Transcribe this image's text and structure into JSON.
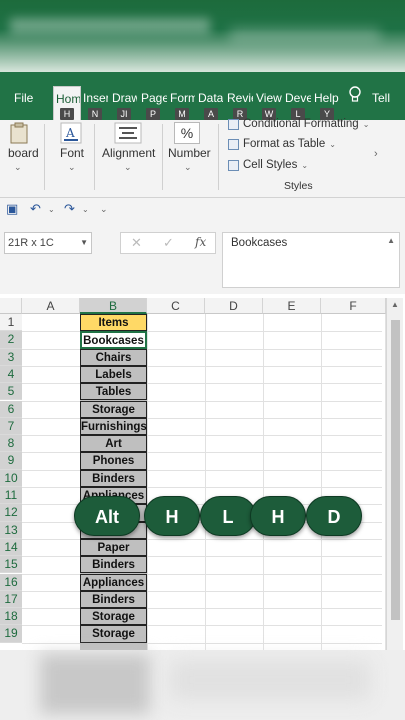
{
  "window": {
    "title_blurred": "Duplicate Highlight"
  },
  "ribbon": {
    "tabs": [
      {
        "label": "File",
        "keytip": ""
      },
      {
        "label": "Hom",
        "keytip": "H"
      },
      {
        "label": "Inser",
        "keytip": "N"
      },
      {
        "label": "Draw",
        "keytip": "JI"
      },
      {
        "label": "Page",
        "keytip": "P"
      },
      {
        "label": "Form",
        "keytip": "M"
      },
      {
        "label": "Data",
        "keytip": "A"
      },
      {
        "label": "Revie",
        "keytip": "R"
      },
      {
        "label": "View",
        "keytip": "W"
      },
      {
        "label": "Deve",
        "keytip": "L"
      },
      {
        "label": "Help",
        "keytip": "Y"
      },
      {
        "label": "Tell",
        "keytip": ""
      }
    ],
    "groups": {
      "clipboard": "board",
      "font": "Font",
      "alignment": "Alignment",
      "number": "Number",
      "number_symbol": "%",
      "styles": "Styles"
    },
    "styles_items": {
      "conditional": "Conditional Formatting",
      "format_table": "Format as Table",
      "cell_styles": "Cell Styles"
    }
  },
  "formula_bar": {
    "name_box": "21R x 1C",
    "value": "Bookcases",
    "fx": "fx"
  },
  "grid": {
    "columns": [
      "A",
      "B",
      "C",
      "D",
      "E",
      "F"
    ],
    "selected_column": "B",
    "rows": [
      "1",
      "2",
      "3",
      "4",
      "5",
      "6",
      "7",
      "8",
      "9",
      "10",
      "11",
      "12",
      "13",
      "14",
      "15",
      "16",
      "17",
      "18",
      "19"
    ],
    "column_b": [
      "Items",
      "Bookcases",
      "Chairs",
      "Labels",
      "Tables",
      "Storage",
      "Furnishings",
      "Art",
      "Phones",
      "Binders",
      "Appliances",
      "",
      "",
      "Paper",
      "Binders",
      "Appliances",
      "Binders",
      "Storage",
      "Storage"
    ]
  },
  "keys_overlay": [
    "Alt",
    "H",
    "L",
    "H",
    "D"
  ],
  "colors": {
    "excel_green": "#217346",
    "header_fill": "#ffd966",
    "selection_fill": "#bfbfbf",
    "key_green": "#1d5c3a"
  }
}
